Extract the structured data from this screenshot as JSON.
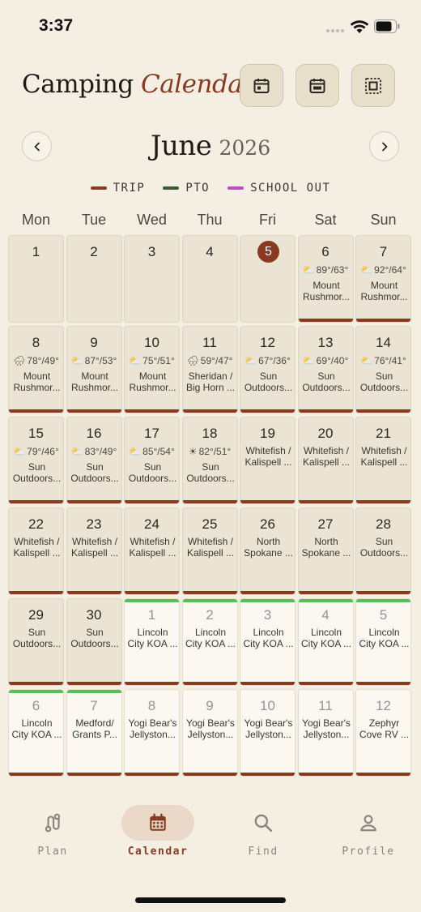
{
  "status": {
    "time": "3:37"
  },
  "header": {
    "title_main": "Camping",
    "title_accent": "Calendar"
  },
  "month": {
    "name": "June",
    "year": "2026"
  },
  "legend": [
    {
      "label": "TRIP",
      "color": "#8b3a22"
    },
    {
      "label": "PTO",
      "color": "#3d5a34"
    },
    {
      "label": "SCHOOL OUT",
      "color": "#b84fc3"
    }
  ],
  "weekdays": [
    "Mon",
    "Tue",
    "Wed",
    "Thu",
    "Fri",
    "Sat",
    "Sun"
  ],
  "days": [
    {
      "num": "1"
    },
    {
      "num": "2"
    },
    {
      "num": "3"
    },
    {
      "num": "4"
    },
    {
      "num": "5",
      "today": true
    },
    {
      "num": "6",
      "weather_icon": "cloud-sun",
      "weather": "89°/63°",
      "location": [
        "Mount",
        "Rushmor..."
      ],
      "trip": true
    },
    {
      "num": "7",
      "weather_icon": "cloud-sun",
      "weather": "92°/64°",
      "location": [
        "Mount",
        "Rushmor..."
      ],
      "trip": true
    },
    {
      "num": "8",
      "weather_icon": "rain",
      "weather": "78°/49°",
      "location": [
        "Mount",
        "Rushmor..."
      ],
      "trip": true
    },
    {
      "num": "9",
      "weather_icon": "cloud-sun",
      "weather": "87°/53°",
      "location": [
        "Mount",
        "Rushmor..."
      ],
      "trip": true
    },
    {
      "num": "10",
      "weather_icon": "cloud-sun",
      "weather": "75°/51°",
      "location": [
        "Mount",
        "Rushmor..."
      ],
      "trip": true
    },
    {
      "num": "11",
      "weather_icon": "rain",
      "weather": "59°/47°",
      "location": [
        "Sheridan /",
        "Big Horn ..."
      ],
      "trip": true
    },
    {
      "num": "12",
      "weather_icon": "cloud-sun",
      "weather": "67°/36°",
      "location": [
        "Sun",
        "Outdoors..."
      ],
      "trip": true
    },
    {
      "num": "13",
      "weather_icon": "cloud-sun",
      "weather": "69°/40°",
      "location": [
        "Sun",
        "Outdoors..."
      ],
      "trip": true
    },
    {
      "num": "14",
      "weather_icon": "cloud-sun",
      "weather": "76°/41°",
      "location": [
        "Sun",
        "Outdoors..."
      ],
      "trip": true
    },
    {
      "num": "15",
      "weather_icon": "cloud-sun",
      "weather": "79°/46°",
      "location": [
        "Sun",
        "Outdoors..."
      ],
      "trip": true
    },
    {
      "num": "16",
      "weather_icon": "cloud-sun",
      "weather": "83°/49°",
      "location": [
        "Sun",
        "Outdoors..."
      ],
      "trip": true
    },
    {
      "num": "17",
      "weather_icon": "cloud-sun",
      "weather": "85°/54°",
      "location": [
        "Sun",
        "Outdoors..."
      ],
      "trip": true
    },
    {
      "num": "18",
      "weather_icon": "sun",
      "weather": "82°/51°",
      "location": [
        "Sun",
        "Outdoors..."
      ],
      "trip": true
    },
    {
      "num": "19",
      "location": [
        "Whitefish /",
        "Kalispell ..."
      ],
      "trip": true
    },
    {
      "num": "20",
      "location": [
        "Whitefish /",
        "Kalispell ..."
      ],
      "trip": true
    },
    {
      "num": "21",
      "location": [
        "Whitefish /",
        "Kalispell ..."
      ],
      "trip": true
    },
    {
      "num": "22",
      "location": [
        "Whitefish /",
        "Kalispell ..."
      ],
      "trip": true
    },
    {
      "num": "23",
      "location": [
        "Whitefish /",
        "Kalispell ..."
      ],
      "trip": true
    },
    {
      "num": "24",
      "location": [
        "Whitefish /",
        "Kalispell ..."
      ],
      "trip": true
    },
    {
      "num": "25",
      "location": [
        "Whitefish /",
        "Kalispell ..."
      ],
      "trip": true
    },
    {
      "num": "26",
      "location": [
        "North",
        "Spokane ..."
      ],
      "trip": true
    },
    {
      "num": "27",
      "location": [
        "North",
        "Spokane ..."
      ],
      "trip": true
    },
    {
      "num": "28",
      "location": [
        "Sun",
        "Outdoors..."
      ],
      "trip": true
    },
    {
      "num": "29",
      "location": [
        "Sun",
        "Outdoors..."
      ],
      "trip": true
    },
    {
      "num": "30",
      "location": [
        "Sun",
        "Outdoors..."
      ],
      "trip": true
    },
    {
      "num": "1",
      "next": true,
      "location": [
        "Lincoln",
        "City KOA ..."
      ],
      "trip": true,
      "pto": true
    },
    {
      "num": "2",
      "next": true,
      "location": [
        "Lincoln",
        "City KOA ..."
      ],
      "trip": true,
      "pto": true
    },
    {
      "num": "3",
      "next": true,
      "location": [
        "Lincoln",
        "City KOA ..."
      ],
      "trip": true,
      "pto": true
    },
    {
      "num": "4",
      "next": true,
      "location": [
        "Lincoln",
        "City KOA ..."
      ],
      "trip": true,
      "pto": true
    },
    {
      "num": "5",
      "next": true,
      "location": [
        "Lincoln",
        "City KOA ..."
      ],
      "trip": true,
      "pto": true
    },
    {
      "num": "6",
      "next": true,
      "location": [
        "Lincoln",
        "City KOA ..."
      ],
      "trip": true,
      "pto": true
    },
    {
      "num": "7",
      "next": true,
      "location": [
        "Medford/",
        "Grants P..."
      ],
      "trip": true,
      "pto": true
    },
    {
      "num": "8",
      "next": true,
      "location": [
        "Yogi Bear's",
        "Jellyston..."
      ],
      "trip": true
    },
    {
      "num": "9",
      "next": true,
      "location": [
        "Yogi Bear's",
        "Jellyston..."
      ],
      "trip": true
    },
    {
      "num": "10",
      "next": true,
      "location": [
        "Yogi Bear's",
        "Jellyston..."
      ],
      "trip": true
    },
    {
      "num": "11",
      "next": true,
      "location": [
        "Yogi Bear's",
        "Jellyston..."
      ],
      "trip": true
    },
    {
      "num": "12",
      "next": true,
      "location": [
        "Zephyr",
        "Cove RV ..."
      ],
      "trip": true
    }
  ],
  "tabs": [
    {
      "label": "Plan",
      "icon": "route-icon"
    },
    {
      "label": "Calendar",
      "icon": "calendar-icon",
      "active": true
    },
    {
      "label": "Find",
      "icon": "search-icon"
    },
    {
      "label": "Profile",
      "icon": "person-icon"
    }
  ]
}
